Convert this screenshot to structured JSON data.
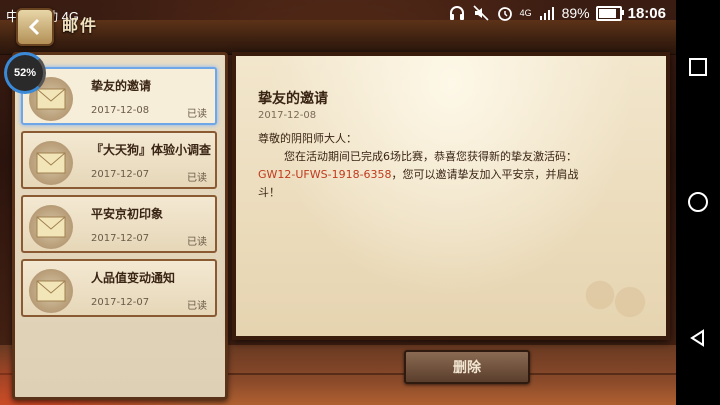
{
  "status_bar": {
    "carrier": "中国移动 4G",
    "network": "4G",
    "battery_percent": "89%",
    "time": "18:06"
  },
  "header": {
    "title": "邮件",
    "performance_badge": "52%"
  },
  "mail_list": [
    {
      "title": "挚友的邀请",
      "date": "2017-12-08",
      "status": "已读",
      "selected": true
    },
    {
      "title": "『大天狗』体验小调查",
      "date": "2017-12-07",
      "status": "已读",
      "selected": false
    },
    {
      "title": "平安京初印象",
      "date": "2017-12-07",
      "status": "已读",
      "selected": false
    },
    {
      "title": "人品值变动通知",
      "date": "2017-12-07",
      "status": "已读",
      "selected": false
    }
  ],
  "detail": {
    "title": "挚友的邀请",
    "date": "2017-12-08",
    "greeting": "尊敬的阴阳师大人：",
    "line1": "您在活动期间已完成6场比赛，恭喜您获得新的挚友激活码：",
    "code": "GW12-UFWS-1918-6358",
    "line2_after_code": "，您可以邀请挚友加入平安京，并肩战",
    "line3": "斗！"
  },
  "actions": {
    "delete_label": "删除"
  },
  "colors": {
    "accent_red": "#c03a1e",
    "selected_border": "#6ea6e8",
    "panel_frame": "#3a1c0c"
  }
}
